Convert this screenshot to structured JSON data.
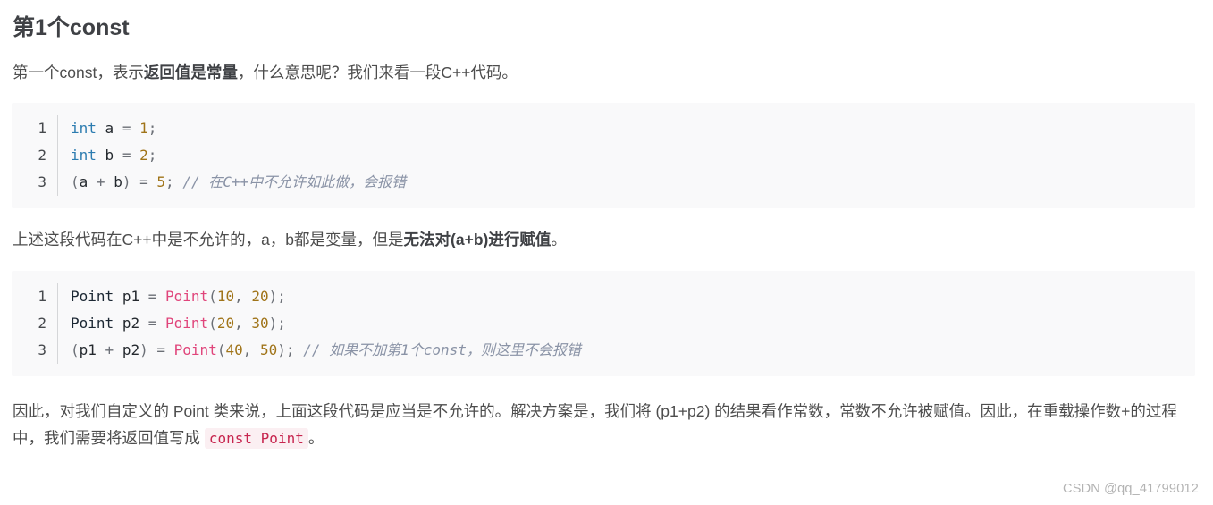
{
  "article": {
    "heading": "第1个const",
    "paragraph_intro": {
      "part1": "第一个const，表示",
      "bold1": "返回值是常量",
      "part2": "，什么意思呢？我们来看一段C++代码。"
    },
    "paragraph_mid": {
      "part1": "上述这段代码在C++中是不允许的，a，b都是变量，但是",
      "bold1": "无法对(a+b)进行赋值",
      "part2": "。"
    },
    "paragraph_final": {
      "part1": "因此，对我们自定义的 Point 类来说，上面这段代码是应当是不允许的。解决方案是，我们将 (p1+p2) 的结果看作常数，常数不允许被赋值。因此，在重载操作数+的过程中，我们需要将返回值写成 ",
      "inline_code": "const Point",
      "part2": "。"
    }
  },
  "code_block_1": {
    "language": "cpp",
    "lines": [
      {
        "number": "1",
        "tokens": [
          {
            "text": "int",
            "type": "kw"
          },
          {
            "text": " ",
            "type": "plain"
          },
          {
            "text": "a",
            "type": "ident"
          },
          {
            "text": " ",
            "type": "plain"
          },
          {
            "text": "=",
            "type": "op"
          },
          {
            "text": " ",
            "type": "plain"
          },
          {
            "text": "1",
            "type": "num"
          },
          {
            "text": ";",
            "type": "punct"
          }
        ]
      },
      {
        "number": "2",
        "tokens": [
          {
            "text": "int",
            "type": "kw"
          },
          {
            "text": " ",
            "type": "plain"
          },
          {
            "text": "b",
            "type": "ident"
          },
          {
            "text": " ",
            "type": "plain"
          },
          {
            "text": "=",
            "type": "op"
          },
          {
            "text": " ",
            "type": "plain"
          },
          {
            "text": "2",
            "type": "num"
          },
          {
            "text": ";",
            "type": "punct"
          }
        ]
      },
      {
        "number": "3",
        "tokens": [
          {
            "text": "(",
            "type": "punct"
          },
          {
            "text": "a",
            "type": "ident"
          },
          {
            "text": " ",
            "type": "plain"
          },
          {
            "text": "+",
            "type": "op"
          },
          {
            "text": " ",
            "type": "plain"
          },
          {
            "text": "b",
            "type": "ident"
          },
          {
            "text": ")",
            "type": "punct"
          },
          {
            "text": " ",
            "type": "plain"
          },
          {
            "text": "=",
            "type": "op"
          },
          {
            "text": " ",
            "type": "plain"
          },
          {
            "text": "5",
            "type": "num"
          },
          {
            "text": ";",
            "type": "punct"
          },
          {
            "text": " ",
            "type": "plain"
          },
          {
            "text": "// 在C++中不允许如此做，会报错",
            "type": "comment"
          }
        ]
      }
    ]
  },
  "code_block_2": {
    "language": "cpp",
    "lines": [
      {
        "number": "1",
        "tokens": [
          {
            "text": "Point",
            "type": "type"
          },
          {
            "text": " ",
            "type": "plain"
          },
          {
            "text": "p1",
            "type": "ident"
          },
          {
            "text": " ",
            "type": "plain"
          },
          {
            "text": "=",
            "type": "op"
          },
          {
            "text": " ",
            "type": "plain"
          },
          {
            "text": "Point",
            "type": "fn"
          },
          {
            "text": "(",
            "type": "punct"
          },
          {
            "text": "10",
            "type": "num"
          },
          {
            "text": ", ",
            "type": "punct"
          },
          {
            "text": "20",
            "type": "num"
          },
          {
            "text": ")",
            "type": "punct"
          },
          {
            "text": ";",
            "type": "punct"
          }
        ]
      },
      {
        "number": "2",
        "tokens": [
          {
            "text": "Point",
            "type": "type"
          },
          {
            "text": " ",
            "type": "plain"
          },
          {
            "text": "p2",
            "type": "ident"
          },
          {
            "text": " ",
            "type": "plain"
          },
          {
            "text": "=",
            "type": "op"
          },
          {
            "text": " ",
            "type": "plain"
          },
          {
            "text": "Point",
            "type": "fn"
          },
          {
            "text": "(",
            "type": "punct"
          },
          {
            "text": "20",
            "type": "num"
          },
          {
            "text": ", ",
            "type": "punct"
          },
          {
            "text": "30",
            "type": "num"
          },
          {
            "text": ")",
            "type": "punct"
          },
          {
            "text": ";",
            "type": "punct"
          }
        ]
      },
      {
        "number": "3",
        "tokens": [
          {
            "text": "(",
            "type": "punct"
          },
          {
            "text": "p1",
            "type": "ident"
          },
          {
            "text": " ",
            "type": "plain"
          },
          {
            "text": "+",
            "type": "op"
          },
          {
            "text": " ",
            "type": "plain"
          },
          {
            "text": "p2",
            "type": "ident"
          },
          {
            "text": ")",
            "type": "punct"
          },
          {
            "text": " ",
            "type": "plain"
          },
          {
            "text": "=",
            "type": "op"
          },
          {
            "text": " ",
            "type": "plain"
          },
          {
            "text": "Point",
            "type": "fn"
          },
          {
            "text": "(",
            "type": "punct"
          },
          {
            "text": "40",
            "type": "num"
          },
          {
            "text": ", ",
            "type": "punct"
          },
          {
            "text": "50",
            "type": "num"
          },
          {
            "text": ")",
            "type": "punct"
          },
          {
            "text": ";",
            "type": "punct"
          },
          {
            "text": " ",
            "type": "plain"
          },
          {
            "text": "// 如果不加第1个const，则这里不会报错",
            "type": "comment"
          }
        ]
      }
    ]
  },
  "watermark": {
    "text": "CSDN @qq_41799012"
  },
  "colors": {
    "page_background": "#ffffff",
    "heading_text": "#3f4145",
    "body_text": "#4d4d4d",
    "code_background": "#f9f9fa",
    "line_number": "#46494d",
    "gutter_divider": "#d5d6d8",
    "keyword": "#2c7cb0",
    "number": "#a07419",
    "punctuation": "#6b6f76",
    "function": "#e0457b",
    "comment": "#8a93a6",
    "inline_code_text": "#c7254e",
    "inline_code_background": "#fbeff2",
    "watermark": "#b3b3b3"
  }
}
